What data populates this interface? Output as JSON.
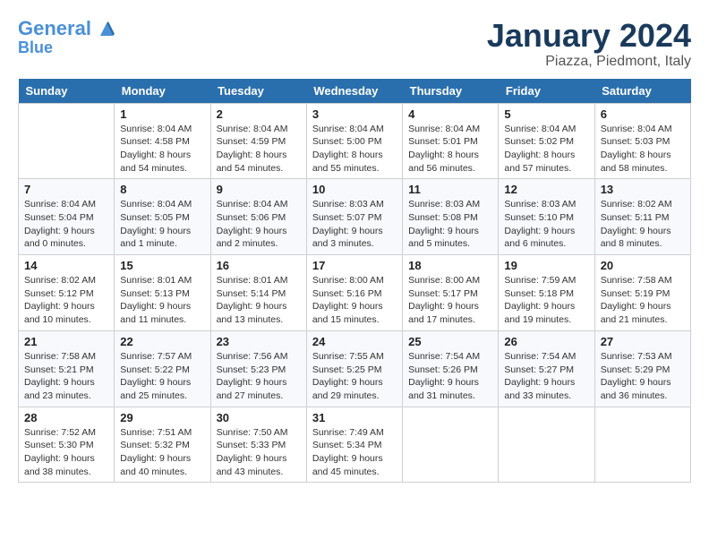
{
  "logo": {
    "line1": "General",
    "line2": "Blue"
  },
  "header": {
    "month": "January 2024",
    "location": "Piazza, Piedmont, Italy"
  },
  "weekdays": [
    "Sunday",
    "Monday",
    "Tuesday",
    "Wednesday",
    "Thursday",
    "Friday",
    "Saturday"
  ],
  "weeks": [
    [
      {
        "day": "",
        "sunrise": "",
        "sunset": "",
        "daylight": ""
      },
      {
        "day": "1",
        "sunrise": "Sunrise: 8:04 AM",
        "sunset": "Sunset: 4:58 PM",
        "daylight": "Daylight: 8 hours and 54 minutes."
      },
      {
        "day": "2",
        "sunrise": "Sunrise: 8:04 AM",
        "sunset": "Sunset: 4:59 PM",
        "daylight": "Daylight: 8 hours and 54 minutes."
      },
      {
        "day": "3",
        "sunrise": "Sunrise: 8:04 AM",
        "sunset": "Sunset: 5:00 PM",
        "daylight": "Daylight: 8 hours and 55 minutes."
      },
      {
        "day": "4",
        "sunrise": "Sunrise: 8:04 AM",
        "sunset": "Sunset: 5:01 PM",
        "daylight": "Daylight: 8 hours and 56 minutes."
      },
      {
        "day": "5",
        "sunrise": "Sunrise: 8:04 AM",
        "sunset": "Sunset: 5:02 PM",
        "daylight": "Daylight: 8 hours and 57 minutes."
      },
      {
        "day": "6",
        "sunrise": "Sunrise: 8:04 AM",
        "sunset": "Sunset: 5:03 PM",
        "daylight": "Daylight: 8 hours and 58 minutes."
      }
    ],
    [
      {
        "day": "7",
        "sunrise": "Sunrise: 8:04 AM",
        "sunset": "Sunset: 5:04 PM",
        "daylight": "Daylight: 9 hours and 0 minutes."
      },
      {
        "day": "8",
        "sunrise": "Sunrise: 8:04 AM",
        "sunset": "Sunset: 5:05 PM",
        "daylight": "Daylight: 9 hours and 1 minute."
      },
      {
        "day": "9",
        "sunrise": "Sunrise: 8:04 AM",
        "sunset": "Sunset: 5:06 PM",
        "daylight": "Daylight: 9 hours and 2 minutes."
      },
      {
        "day": "10",
        "sunrise": "Sunrise: 8:03 AM",
        "sunset": "Sunset: 5:07 PM",
        "daylight": "Daylight: 9 hours and 3 minutes."
      },
      {
        "day": "11",
        "sunrise": "Sunrise: 8:03 AM",
        "sunset": "Sunset: 5:08 PM",
        "daylight": "Daylight: 9 hours and 5 minutes."
      },
      {
        "day": "12",
        "sunrise": "Sunrise: 8:03 AM",
        "sunset": "Sunset: 5:10 PM",
        "daylight": "Daylight: 9 hours and 6 minutes."
      },
      {
        "day": "13",
        "sunrise": "Sunrise: 8:02 AM",
        "sunset": "Sunset: 5:11 PM",
        "daylight": "Daylight: 9 hours and 8 minutes."
      }
    ],
    [
      {
        "day": "14",
        "sunrise": "Sunrise: 8:02 AM",
        "sunset": "Sunset: 5:12 PM",
        "daylight": "Daylight: 9 hours and 10 minutes."
      },
      {
        "day": "15",
        "sunrise": "Sunrise: 8:01 AM",
        "sunset": "Sunset: 5:13 PM",
        "daylight": "Daylight: 9 hours and 11 minutes."
      },
      {
        "day": "16",
        "sunrise": "Sunrise: 8:01 AM",
        "sunset": "Sunset: 5:14 PM",
        "daylight": "Daylight: 9 hours and 13 minutes."
      },
      {
        "day": "17",
        "sunrise": "Sunrise: 8:00 AM",
        "sunset": "Sunset: 5:16 PM",
        "daylight": "Daylight: 9 hours and 15 minutes."
      },
      {
        "day": "18",
        "sunrise": "Sunrise: 8:00 AM",
        "sunset": "Sunset: 5:17 PM",
        "daylight": "Daylight: 9 hours and 17 minutes."
      },
      {
        "day": "19",
        "sunrise": "Sunrise: 7:59 AM",
        "sunset": "Sunset: 5:18 PM",
        "daylight": "Daylight: 9 hours and 19 minutes."
      },
      {
        "day": "20",
        "sunrise": "Sunrise: 7:58 AM",
        "sunset": "Sunset: 5:19 PM",
        "daylight": "Daylight: 9 hours and 21 minutes."
      }
    ],
    [
      {
        "day": "21",
        "sunrise": "Sunrise: 7:58 AM",
        "sunset": "Sunset: 5:21 PM",
        "daylight": "Daylight: 9 hours and 23 minutes."
      },
      {
        "day": "22",
        "sunrise": "Sunrise: 7:57 AM",
        "sunset": "Sunset: 5:22 PM",
        "daylight": "Daylight: 9 hours and 25 minutes."
      },
      {
        "day": "23",
        "sunrise": "Sunrise: 7:56 AM",
        "sunset": "Sunset: 5:23 PM",
        "daylight": "Daylight: 9 hours and 27 minutes."
      },
      {
        "day": "24",
        "sunrise": "Sunrise: 7:55 AM",
        "sunset": "Sunset: 5:25 PM",
        "daylight": "Daylight: 9 hours and 29 minutes."
      },
      {
        "day": "25",
        "sunrise": "Sunrise: 7:54 AM",
        "sunset": "Sunset: 5:26 PM",
        "daylight": "Daylight: 9 hours and 31 minutes."
      },
      {
        "day": "26",
        "sunrise": "Sunrise: 7:54 AM",
        "sunset": "Sunset: 5:27 PM",
        "daylight": "Daylight: 9 hours and 33 minutes."
      },
      {
        "day": "27",
        "sunrise": "Sunrise: 7:53 AM",
        "sunset": "Sunset: 5:29 PM",
        "daylight": "Daylight: 9 hours and 36 minutes."
      }
    ],
    [
      {
        "day": "28",
        "sunrise": "Sunrise: 7:52 AM",
        "sunset": "Sunset: 5:30 PM",
        "daylight": "Daylight: 9 hours and 38 minutes."
      },
      {
        "day": "29",
        "sunrise": "Sunrise: 7:51 AM",
        "sunset": "Sunset: 5:32 PM",
        "daylight": "Daylight: 9 hours and 40 minutes."
      },
      {
        "day": "30",
        "sunrise": "Sunrise: 7:50 AM",
        "sunset": "Sunset: 5:33 PM",
        "daylight": "Daylight: 9 hours and 43 minutes."
      },
      {
        "day": "31",
        "sunrise": "Sunrise: 7:49 AM",
        "sunset": "Sunset: 5:34 PM",
        "daylight": "Daylight: 9 hours and 45 minutes."
      },
      {
        "day": "",
        "sunrise": "",
        "sunset": "",
        "daylight": ""
      },
      {
        "day": "",
        "sunrise": "",
        "sunset": "",
        "daylight": ""
      },
      {
        "day": "",
        "sunrise": "",
        "sunset": "",
        "daylight": ""
      }
    ]
  ]
}
